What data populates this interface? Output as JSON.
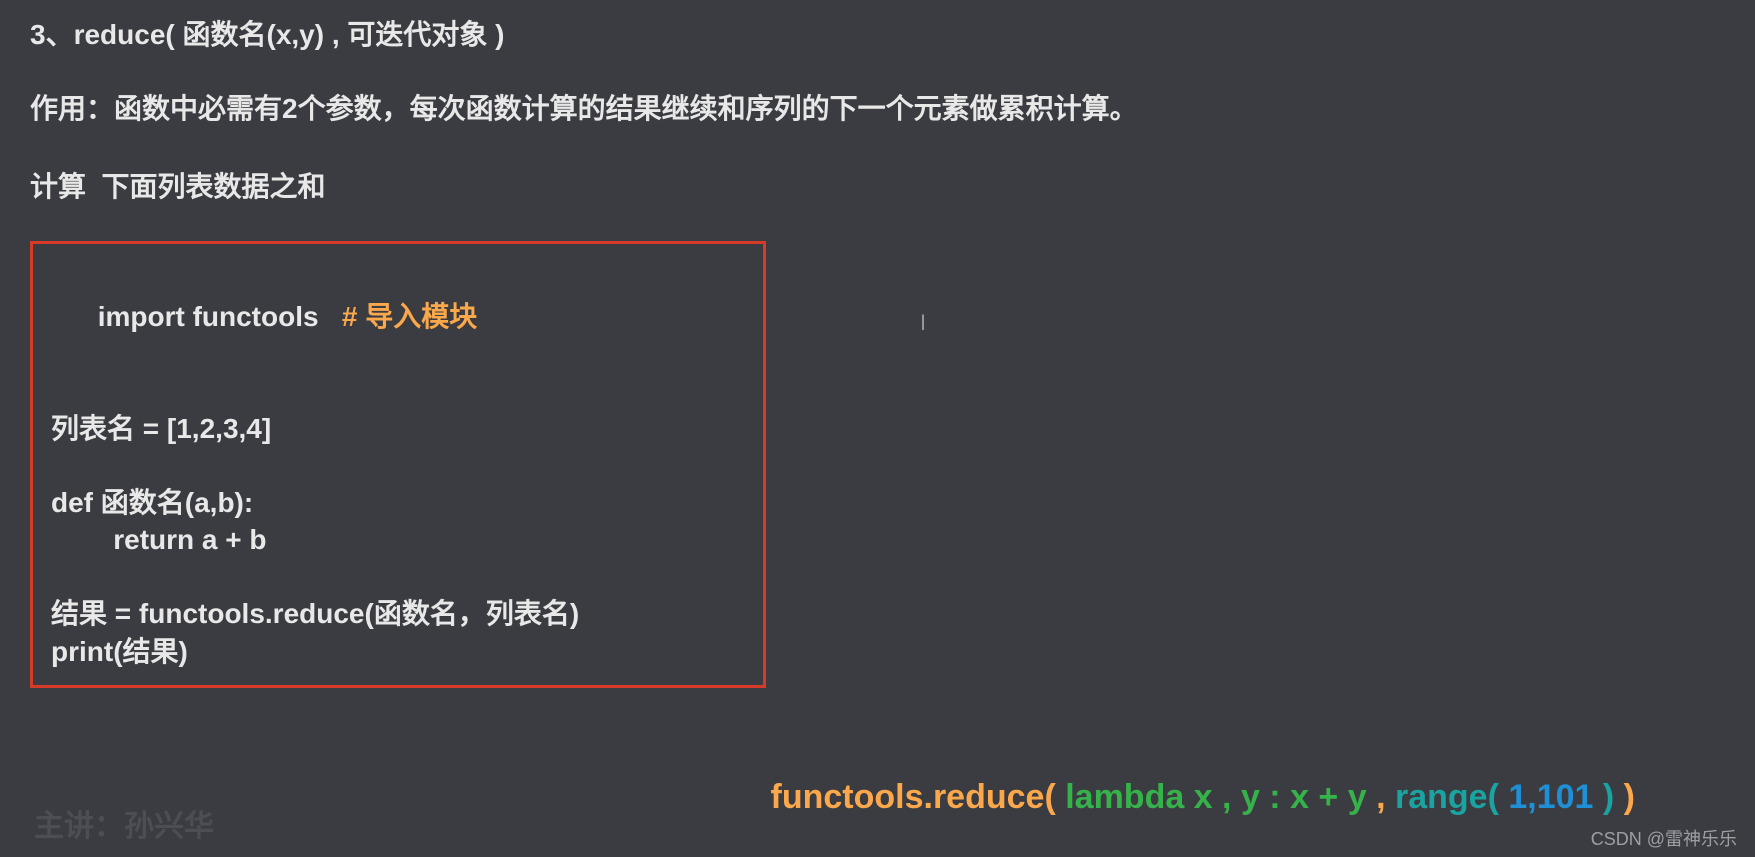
{
  "heading": "3、reduce( 函数名(x,y) , 可迭代对象 )",
  "description": "作用：函数中必需有2个参数，每次函数计算的结果继续和序列的下一个元素做累积计算。",
  "subheading": "计算  下面列表数据之和",
  "code": {
    "l1a": "import functools",
    "l1b": "   # 导入模块",
    "l2": "列表名 = [1,2,3,4]",
    "l3": "def 函数名(a,b):",
    "l4": "        return a + b",
    "l5": "结果 = functools.reduce(函数名，列表名)",
    "l6": "print(结果)"
  },
  "footer": {
    "p1": "functools.reduce( ",
    "p2": "lambda x , y : x + y ",
    "p3": ", ",
    "p4": "range( ",
    "p5": "1,101 ",
    "p6": ") ",
    "p7": ")"
  },
  "speaker": "主讲：孙兴华",
  "watermark": "CSDN @雷神乐乐"
}
